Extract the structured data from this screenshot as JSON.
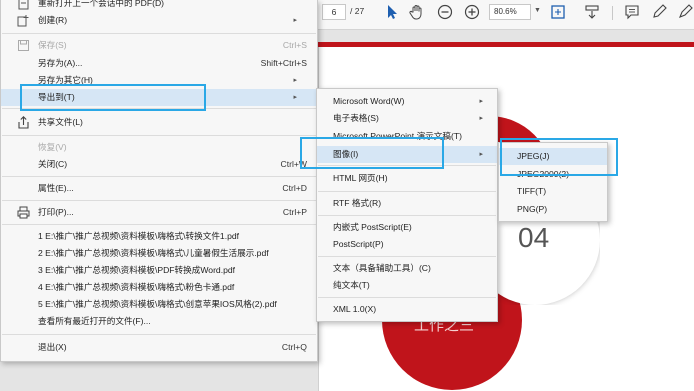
{
  "toolbar": {
    "page_current": "6",
    "page_total": "/ 27",
    "zoom": "80.6%"
  },
  "document": {
    "number_text": "04",
    "work_text": "工作之三"
  },
  "file_menu": {
    "recent_header": "重新打开上一个会话中的 PDF(D)",
    "create": "创建(R)",
    "save": "保存(S)",
    "save_sc": "Ctrl+S",
    "save_as": "另存为(A)...",
    "save_as_sc": "Shift+Ctrl+S",
    "save_as_other": "另存为其它(H)",
    "export_to": "导出到(T)",
    "share": "共享文件(L)",
    "revert": "恢复(V)",
    "close": "关闭(C)",
    "close_sc": "Ctrl+W",
    "properties": "属性(E)...",
    "properties_sc": "Ctrl+D",
    "print": "打印(P)...",
    "print_sc": "Ctrl+P",
    "recent_files": [
      "1 E:\\推广\\推广总视频\\资料模板\\嗨格式\\转换文件1.pdf",
      "2 E:\\推广\\推广总视频\\资料模板\\嗨格式\\儿童暑假生活展示.pdf",
      "3 E:\\推广\\推广总视频\\资料模板\\PDF转换成Word.pdf",
      "4 E:\\推广\\推广总视频\\资料模板\\嗨格式\\粉色卡通.pdf",
      "5 E:\\推广\\推广总视频\\资料模板\\嗨格式\\创意苹果IOS风格(2).pdf"
    ],
    "view_all_recent": "查看所有最近打开的文件(F)...",
    "exit": "退出(X)",
    "exit_sc": "Ctrl+Q"
  },
  "export_menu": {
    "word": "Microsoft Word(W)",
    "spreadsheet": "电子表格(S)",
    "powerpoint": "Microsoft PowerPoint 演示文稿(T)",
    "image": "图像(I)",
    "html": "HTML 网页(H)",
    "rtf": "RTF 格式(R)",
    "eps": "内嵌式 PostScript(E)",
    "postscript": "PostScript(P)",
    "text_accessible": "文本（具备辅助工具）(C)",
    "plain_text": "纯文本(T)",
    "xml": "XML 1.0(X)"
  },
  "image_menu": {
    "jpeg": "JPEG(J)",
    "jpeg2000": "JPEG2000(2)",
    "tiff": "TIFF(T)",
    "png": "PNG(P)"
  },
  "colors": {
    "highlight_callout": "#2aa8e6",
    "document_red": "#c0141b",
    "menu_bg": "#f7f7f7"
  }
}
